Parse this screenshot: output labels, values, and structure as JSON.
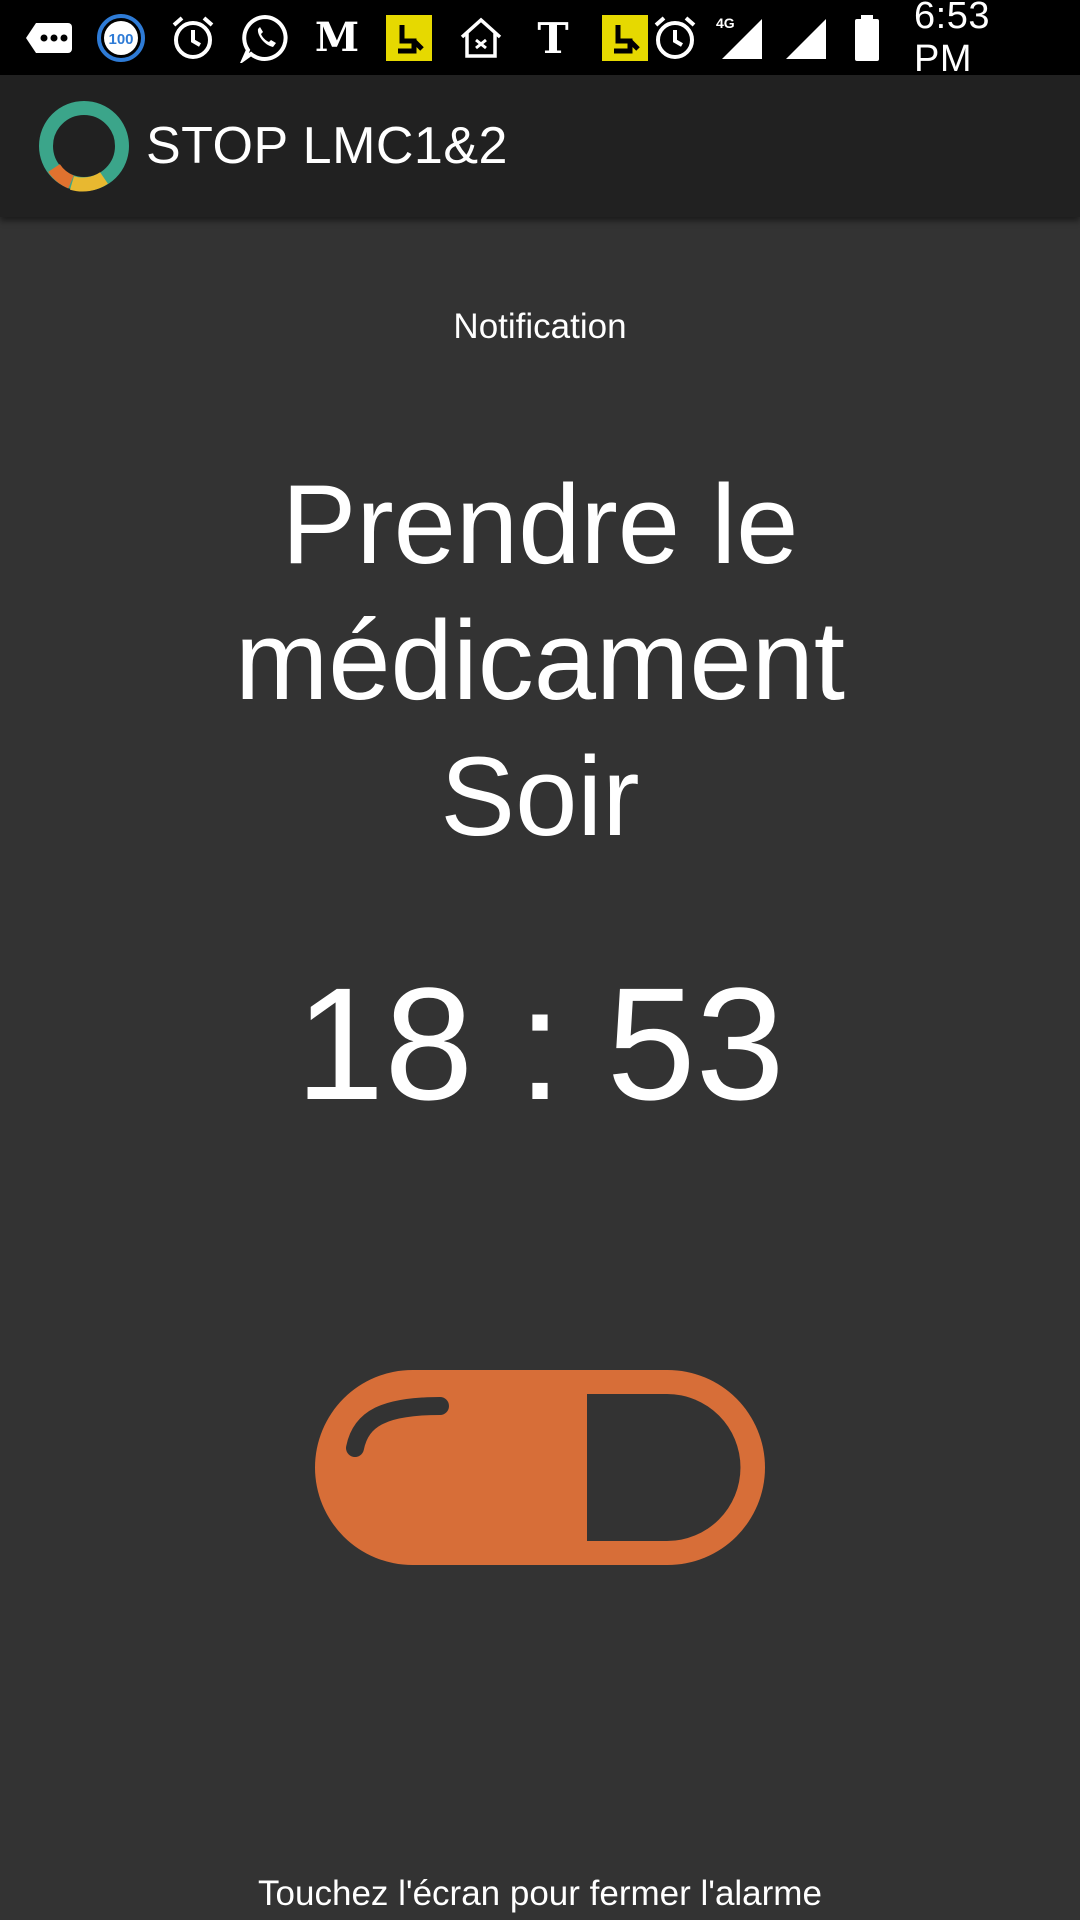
{
  "status_bar": {
    "icons": [
      "more-notifications-icon",
      "battery-100-icon",
      "alarm-icon",
      "whatsapp-icon",
      "le-monde-icon",
      "yellow-app-icon",
      "home-icon",
      "nytimes-icon",
      "yellow-app-icon",
      "alarm-icon",
      "signal-4g-icon",
      "signal-icon",
      "battery-icon"
    ],
    "badge_value": "100",
    "network_label": "4G",
    "time": "6:53 PM"
  },
  "app_bar": {
    "title": "STOP LMC1&2",
    "logo_icon": "app-ring-logo-icon"
  },
  "main": {
    "notification_label": "Notification",
    "message_lines": [
      "Prendre le",
      "médicament",
      "Soir"
    ],
    "alarm_time": "18 : 53",
    "pill_icon": "pill-capsule-icon",
    "dismiss_hint": "Touchez l'écran pour fermer l'alarme"
  },
  "colors": {
    "background": "#333333",
    "status_bar": "#000000",
    "app_bar": "#212121",
    "pill": "#D76E38",
    "text": "#FFFFFF",
    "logo_teal": "#3BA58A",
    "logo_orange": "#E0722F",
    "logo_yellow": "#E8B830",
    "badge_blue": "#2E7BD6",
    "yellow_app": "#E6D900"
  }
}
